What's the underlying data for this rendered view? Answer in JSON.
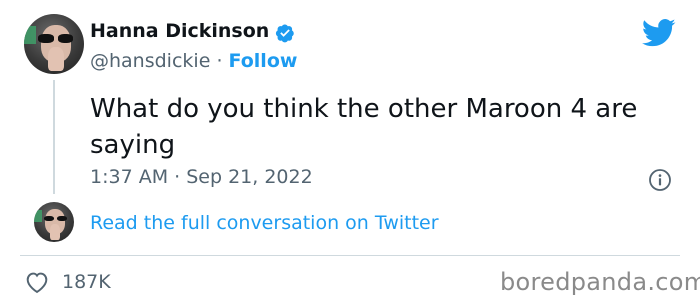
{
  "author": {
    "name": "Hanna Dickinson",
    "handle": "@hansdickie",
    "separator": "·",
    "follow_label": "Follow",
    "verified_icon": "verified-badge-icon"
  },
  "tweet": {
    "text": "What do you think the other Maroon 4 are saying",
    "timestamp": "1:37 AM · Sep 21, 2022"
  },
  "conversation": {
    "link_text": "Read the full conversation on Twitter"
  },
  "stats": {
    "likes": "187K",
    "like_icon": "heart-icon"
  },
  "watermark": "boredpanda.com",
  "colors": {
    "accent": "#1d9bf0",
    "text": "#0f1419",
    "muted": "#536471",
    "divider": "#cfd9de"
  },
  "icons": [
    "twitter-bird-icon",
    "info-icon",
    "heart-icon",
    "verified-badge-icon"
  ]
}
